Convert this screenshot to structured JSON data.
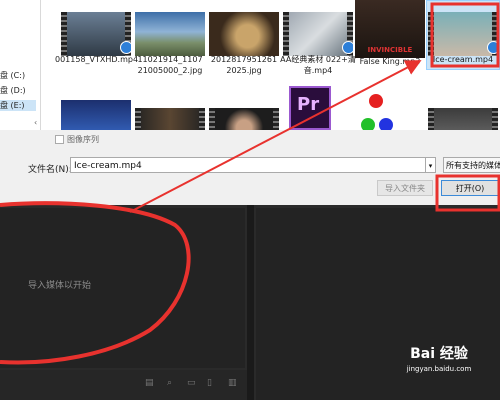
{
  "nav": {
    "drives": [
      "盘 (C:)",
      "盘 (D:)",
      "盘 (E:)"
    ]
  },
  "files": [
    {
      "name": "001158_VTXHD.mp4",
      "icon": "video-thumbnail"
    },
    {
      "name": "11021914_1107 21005000_2.jpg",
      "icon": "image-thumbnail"
    },
    {
      "name": "2012817951261 2025.jpg",
      "icon": "image-thumbnail"
    },
    {
      "name": "AA经典素材 022+清音.mp4",
      "icon": "video-thumbnail"
    },
    {
      "name": "False King.mp3",
      "icon": "album-thumbnail"
    },
    {
      "name": "Ice-cream.mp4",
      "icon": "video-thumbnail"
    }
  ],
  "row2": [
    {
      "icon": "anime-thumbnail"
    },
    {
      "icon": "video-thumbnail"
    },
    {
      "icon": "video-thumbnail"
    },
    {
      "icon": "premiere-file-icon",
      "text": "Pr"
    },
    {
      "icon": "rgb-dots-image"
    },
    {
      "icon": "video-thumbnail"
    }
  ],
  "sequence_checkbox": "图像序列",
  "filename_label": "文件名(N):",
  "filename_value": "Ice-cream.mp4",
  "filetype_value": "所有支持的媒体",
  "import_folder_label": "导入文件夹",
  "open_label": "打开(O)",
  "empty_text": "导入媒体以开始",
  "watermark": {
    "logo": "Bai 经验",
    "url": "jingyan.baidu.com"
  },
  "colors": {
    "annotation": "#e8322e",
    "selection": "#cce4f7",
    "panel": "#232323"
  }
}
